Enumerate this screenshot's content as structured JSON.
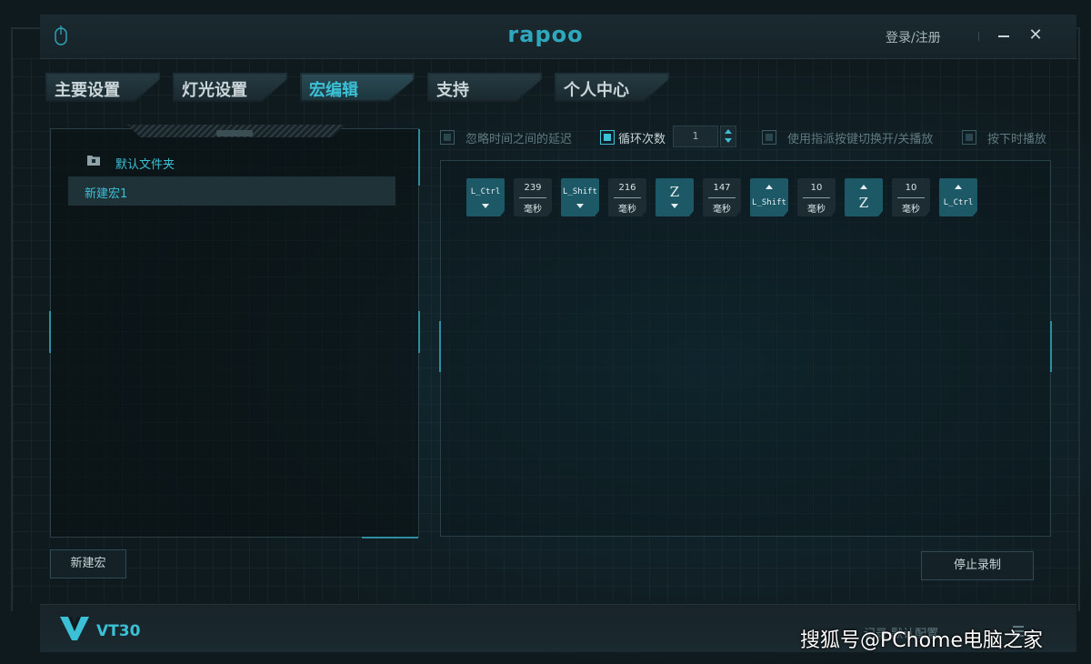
{
  "app": {
    "logo": "rapoo",
    "login_label": "登录/注册",
    "close_glyph": "✕"
  },
  "tabs": [
    {
      "label": "主要设置",
      "active": false
    },
    {
      "label": "灯光设置",
      "active": false
    },
    {
      "label": "宏编辑",
      "active": true
    },
    {
      "label": "支持",
      "active": false
    },
    {
      "label": "个人中心",
      "active": false
    }
  ],
  "macro_list": {
    "folder_label": "默认文件夹",
    "items": [
      "新建宏1"
    ]
  },
  "options": {
    "ignore_delay": {
      "label": "忽略时间之间的延迟",
      "checked": false
    },
    "loop_count": {
      "label": "循环次数",
      "checked": true,
      "value": "1"
    },
    "toggle_by_key": {
      "label": "使用指派按键切换开/关播放",
      "checked": false
    },
    "play_while_pressed": {
      "label": "按下时播放",
      "checked": false
    }
  },
  "sequence": [
    {
      "type": "key",
      "name": "L_Ctrl",
      "action": "down"
    },
    {
      "type": "delay",
      "value": "239",
      "unit": "毫秒"
    },
    {
      "type": "key",
      "name": "L_Shift",
      "action": "down"
    },
    {
      "type": "delay",
      "value": "216",
      "unit": "毫秒"
    },
    {
      "type": "key",
      "name": "Z",
      "action": "down"
    },
    {
      "type": "delay",
      "value": "147",
      "unit": "毫秒"
    },
    {
      "type": "key",
      "name": "L_Shift",
      "action": "up"
    },
    {
      "type": "delay",
      "value": "10",
      "unit": "毫秒"
    },
    {
      "type": "key",
      "name": "Z",
      "action": "up"
    },
    {
      "type": "delay",
      "value": "10",
      "unit": "毫秒"
    },
    {
      "type": "key",
      "name": "L_Ctrl",
      "action": "up"
    }
  ],
  "buttons": {
    "new_macro": "新建宏",
    "stop_record": "停止录制"
  },
  "footer": {
    "brand": "VT30",
    "links": "记录    默认配置",
    "watermark": "搜狐号@PChome电脑之家"
  },
  "colors": {
    "accent": "#3cc0d6",
    "key_bg": "#1d5866",
    "delay_bg": "#1c2c32",
    "background": "#0f1a1e"
  },
  "icons": {
    "mouse": "mouse-icon",
    "folder": "folder-icon",
    "minimize": "minimize-icon",
    "close": "close-icon",
    "stepper": "stepper-icon",
    "menu": "menu-icon"
  }
}
